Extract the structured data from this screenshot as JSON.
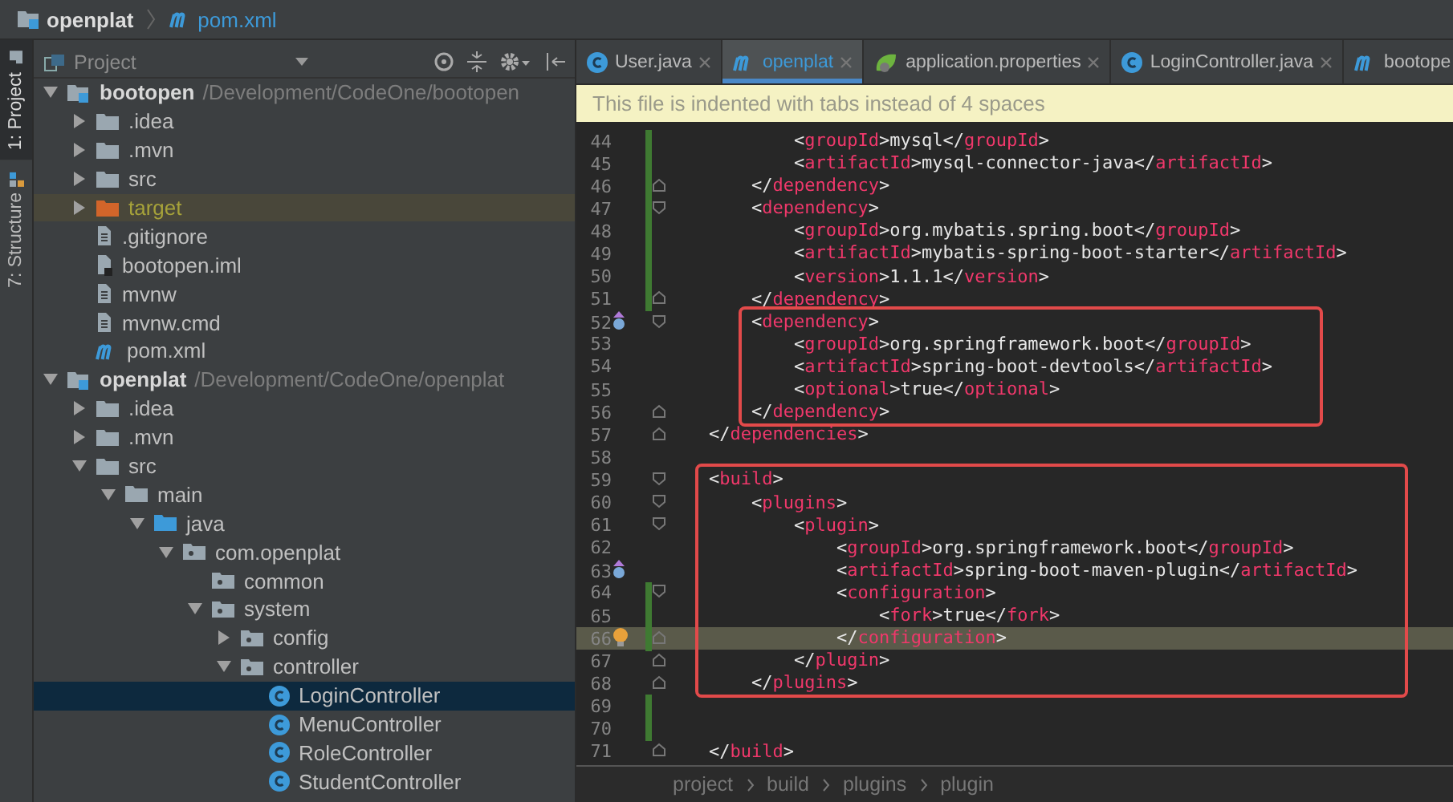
{
  "navbar": {
    "crumbs": [
      {
        "label": "openplat",
        "kind": "module"
      },
      {
        "label": "pom.xml",
        "kind": "maven"
      }
    ]
  },
  "tool_strip": [
    {
      "label": "1: Project",
      "kind": "project",
      "selected": true
    },
    {
      "label": "7: Structure",
      "kind": "structure",
      "selected": false
    }
  ],
  "project_panel": {
    "title": "Project",
    "tree": [
      {
        "name": "bootopen",
        "kind": "module",
        "path": "/Development/CodeOne/bootopen",
        "expanded": true,
        "selected": false,
        "children": [
          {
            "name": ".idea",
            "kind": "folder",
            "expanded": false,
            "selected": false
          },
          {
            "name": ".mvn",
            "kind": "folder",
            "expanded": false,
            "selected": false
          },
          {
            "name": "src",
            "kind": "folder",
            "expanded": false,
            "selected": false
          },
          {
            "name": "target",
            "kind": "excluded",
            "expanded": false,
            "selected": false
          },
          {
            "name": ".gitignore",
            "kind": "file",
            "selected": false
          },
          {
            "name": "bootopen.iml",
            "kind": "iml",
            "selected": false
          },
          {
            "name": "mvnw",
            "kind": "file",
            "selected": false
          },
          {
            "name": "mvnw.cmd",
            "kind": "file",
            "selected": false
          },
          {
            "name": "pom.xml",
            "kind": "maven",
            "selected": false
          }
        ]
      },
      {
        "name": "openplat",
        "kind": "module",
        "path": "/Development/CodeOne/openplat",
        "expanded": true,
        "selected": false,
        "children": [
          {
            "name": ".idea",
            "kind": "folder",
            "expanded": false,
            "selected": false
          },
          {
            "name": ".mvn",
            "kind": "folder",
            "expanded": false,
            "selected": false
          },
          {
            "name": "src",
            "kind": "folder",
            "expanded": true,
            "selected": false,
            "children": [
              {
                "name": "main",
                "kind": "folder",
                "expanded": true,
                "selected": false,
                "children": [
                  {
                    "name": "java",
                    "kind": "source",
                    "expanded": true,
                    "selected": false,
                    "children": [
                      {
                        "name": "com.openplat",
                        "kind": "package",
                        "expanded": true,
                        "selected": false,
                        "children": [
                          {
                            "name": "common",
                            "kind": "package",
                            "selected": false
                          },
                          {
                            "name": "system",
                            "kind": "package",
                            "expanded": true,
                            "selected": false,
                            "children": [
                              {
                                "name": "config",
                                "kind": "package",
                                "expanded": false,
                                "selected": false
                              },
                              {
                                "name": "controller",
                                "kind": "package",
                                "expanded": true,
                                "selected": false,
                                "children": [
                                  {
                                    "name": "LoginController",
                                    "kind": "class",
                                    "selected": true
                                  },
                                  {
                                    "name": "MenuController",
                                    "kind": "class",
                                    "selected": false
                                  },
                                  {
                                    "name": "RoleController",
                                    "kind": "class",
                                    "selected": false
                                  },
                                  {
                                    "name": "StudentController",
                                    "kind": "class",
                                    "selected": false
                                  }
                                ]
                              }
                            ]
                          }
                        ]
                      }
                    ]
                  }
                ]
              }
            ]
          }
        ]
      }
    ]
  },
  "tabs": [
    {
      "label": "User.java",
      "kind": "class",
      "selected": false,
      "closable": true
    },
    {
      "label": "openplat",
      "kind": "maven",
      "selected": true,
      "closable": true
    },
    {
      "label": "application.properties",
      "kind": "spring",
      "selected": false,
      "closable": true
    },
    {
      "label": "LoginController.java",
      "kind": "class",
      "selected": false,
      "closable": true
    },
    {
      "label": "bootope",
      "kind": "maven",
      "selected": false,
      "closable": false
    }
  ],
  "notice": "This file is indented with tabs instead of 4 spaces",
  "editor": {
    "segments": [
      {
        "boxed": false,
        "lines": [
          {
            "number": "44",
            "code": "            <groupId>mysql</groupId>",
            "changed": true,
            "current": false
          },
          {
            "number": "45",
            "code": "            <artifactId>mysql-connector-java</artifactId>",
            "changed": true,
            "current": false
          },
          {
            "number": "46",
            "code": "        </dependency>",
            "changed": true,
            "fold": {
              "kind": "end"
            },
            "current": false
          },
          {
            "number": "47",
            "code": "        <dependency>",
            "changed": true,
            "fold": {
              "kind": "start"
            },
            "current": false
          },
          {
            "number": "48",
            "code": "            <groupId>org.mybatis.spring.boot</groupId>",
            "changed": true,
            "current": false
          },
          {
            "number": "49",
            "code": "            <artifactId>mybatis-spring-boot-starter</artifactId>",
            "changed": true,
            "current": false
          },
          {
            "number": "50",
            "code": "            <version>1.1.1</version>",
            "changed": true,
            "current": false
          },
          {
            "number": "51",
            "code": "        </dependency>",
            "changed": true,
            "fold": {
              "kind": "end"
            },
            "current": false
          }
        ]
      },
      {
        "boxed": true,
        "lines": [
          {
            "number": "52",
            "code": "        <dependency>",
            "changed": false,
            "fold": {
              "kind": "start"
            },
            "marker": {
              "kind": "override"
            },
            "current": false
          },
          {
            "number": "53",
            "code": "            <groupId>org.springframework.boot</groupId>",
            "changed": false,
            "current": false
          },
          {
            "number": "54",
            "code": "            <artifactId>spring-boot-devtools</artifactId>",
            "changed": false,
            "current": false
          },
          {
            "number": "55",
            "code": "            <optional>true</optional>",
            "changed": false,
            "current": false
          },
          {
            "number": "56",
            "code": "        </dependency>",
            "changed": false,
            "fold": {
              "kind": "end"
            },
            "current": false
          }
        ]
      },
      {
        "boxed": false,
        "lines": [
          {
            "number": "57",
            "code": "    </dependencies>",
            "changed": false,
            "fold": {
              "kind": "end"
            },
            "current": false
          },
          {
            "number": "58",
            "changed": false,
            "current": false
          }
        ]
      },
      {
        "boxed": true,
        "lines": [
          {
            "number": "59",
            "code": "    <build>",
            "changed": false,
            "fold": {
              "kind": "start"
            },
            "current": false
          },
          {
            "number": "60",
            "code": "        <plugins>",
            "changed": false,
            "fold": {
              "kind": "start"
            },
            "current": false
          },
          {
            "number": "61",
            "code": "            <plugin>",
            "changed": false,
            "fold": {
              "kind": "start"
            },
            "current": false
          },
          {
            "number": "62",
            "code": "                <groupId>org.springframework.boot</groupId>",
            "changed": false,
            "current": false
          },
          {
            "number": "63",
            "code": "                <artifactId>spring-boot-maven-plugin</artifactId>",
            "changed": false,
            "marker": {
              "kind": "override"
            },
            "current": false
          },
          {
            "number": "64",
            "code": "                <configuration>",
            "changed": true,
            "fold": {
              "kind": "start"
            },
            "current": false
          },
          {
            "number": "65",
            "code": "                    <fork>true</fork>",
            "changed": true,
            "current": false
          },
          {
            "number": "66",
            "code": "                </configuration>",
            "changed": true,
            "fold": {
              "kind": "end"
            },
            "marker": {
              "kind": "bulb"
            },
            "current": true
          },
          {
            "number": "67",
            "code": "            </plugin>",
            "changed": false,
            "fold": {
              "kind": "end"
            },
            "current": false
          },
          {
            "number": "68",
            "code": "        </plugins>",
            "changed": false,
            "fold": {
              "kind": "end"
            },
            "current": false
          }
        ]
      },
      {
        "boxed": false,
        "lines": [
          {
            "number": "69",
            "changed": true,
            "current": false
          },
          {
            "number": "70",
            "changed": true,
            "current": false
          },
          {
            "number": "71",
            "code": "    </build>",
            "changed": false,
            "fold": {
              "kind": "end"
            },
            "current": false
          }
        ]
      }
    ]
  },
  "breadcrumbs": [
    "project",
    "build",
    "plugins",
    "plugin"
  ]
}
